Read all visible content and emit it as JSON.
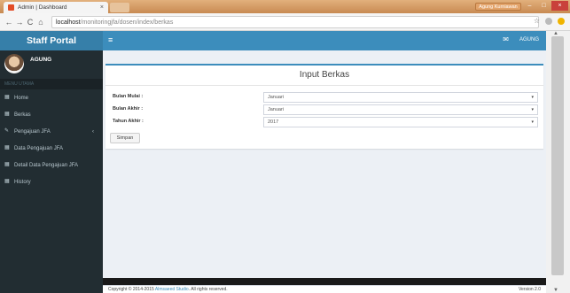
{
  "browser": {
    "tab_title": "Admin | Dashboard",
    "tab_close": "×",
    "user_chip": "Agung Kurniawan",
    "url_host": "localhost",
    "url_path": "/monitoringjfa/dosen/index/berkas",
    "nav_back": "←",
    "nav_forward": "→",
    "nav_reload": "C",
    "nav_home": "⌂",
    "star": "☆",
    "win_min": "–",
    "win_max": "□",
    "win_close": "×"
  },
  "header": {
    "logo": "Staff Portal",
    "menu_toggle": "≡",
    "mail_icon": "✉",
    "user": "AGUNG"
  },
  "sidebar": {
    "username": "AGUNG",
    "menu_header": "MENU UTAMA",
    "items": [
      {
        "label": "Home",
        "icon": "▦"
      },
      {
        "label": "Berkas",
        "icon": "▦"
      },
      {
        "label": "Pengajuan JFA",
        "icon": "✎",
        "chevron": "‹"
      },
      {
        "label": "Data Pengajuan JFA",
        "icon": "▦"
      },
      {
        "label": "Detail Data Pengajuan JFA",
        "icon": "▦"
      },
      {
        "label": "History",
        "icon": "▦"
      }
    ]
  },
  "form": {
    "title": "Input Berkas",
    "fields": [
      {
        "label": "Bulan Mulai :",
        "value": "Januari"
      },
      {
        "label": "Bulan Akhir :",
        "value": "Januari"
      },
      {
        "label": "Tahun Akhir :",
        "value": "2017"
      }
    ],
    "submit": "Simpan",
    "caret": "▾"
  },
  "footer": {
    "prefix": "Copyright © 2014-2015 ",
    "link": "Almsaeed Studio",
    "suffix": ". All rights reserved.",
    "version": "Version 2.0"
  },
  "colors": {
    "header": "#3c8dbc",
    "logo": "#367fa9",
    "sidebar": "#222d32"
  }
}
